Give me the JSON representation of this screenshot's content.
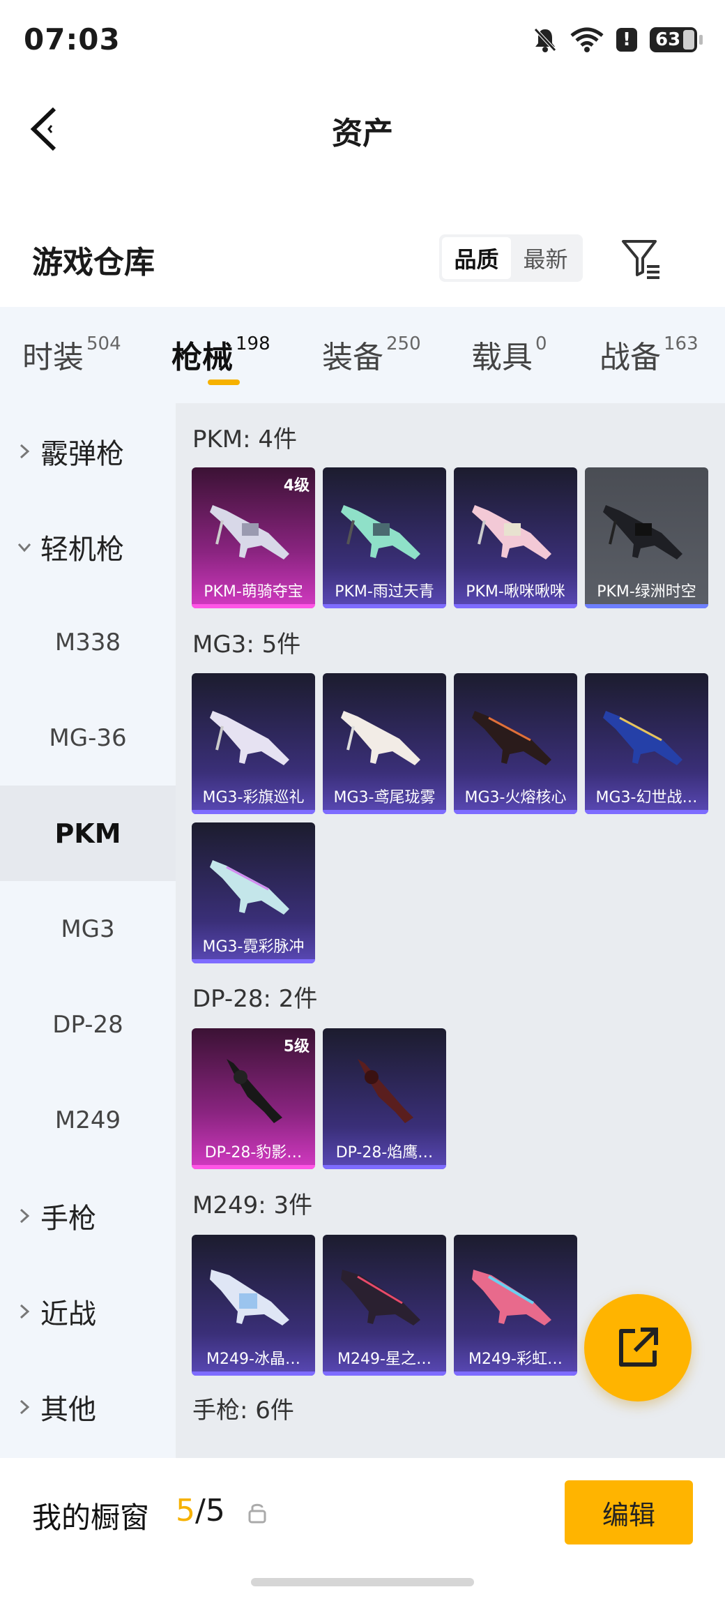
{
  "status_bar": {
    "time": "07:03",
    "battery": "63",
    "alert": "!"
  },
  "header": {
    "title": "资产"
  },
  "warehouse": {
    "title": "游戏仓库",
    "sort_options": [
      "品质",
      "最新"
    ],
    "sort_selected": "品质"
  },
  "tabs": [
    {
      "label": "时装",
      "count": "504"
    },
    {
      "label": "枪械",
      "count": "198"
    },
    {
      "label": "装备",
      "count": "250"
    },
    {
      "label": "载具",
      "count": "0"
    },
    {
      "label": "战备",
      "count": "163"
    }
  ],
  "tab_active": "枪械",
  "sidebar": {
    "groups": [
      {
        "label": "霰弹枪",
        "expanded": false
      },
      {
        "label": "轻机枪",
        "expanded": true
      },
      {
        "label": "手枪",
        "expanded": false
      },
      {
        "label": "近战",
        "expanded": false
      },
      {
        "label": "其他",
        "expanded": false
      }
    ],
    "sub_items": [
      "M338",
      "MG-36",
      "PKM",
      "MG3",
      "DP-28",
      "M249"
    ],
    "selected": "PKM"
  },
  "sections": [
    {
      "title": "PKM: 4件",
      "items": [
        {
          "name": "PKM-萌骑夺宝",
          "level": "4级",
          "rarity": "legendary"
        },
        {
          "name": "PKM-雨过天青",
          "level": "",
          "rarity": "epic"
        },
        {
          "name": "PKM-啾咪啾咪",
          "level": "",
          "rarity": "epic"
        },
        {
          "name": "PKM-绿洲时空",
          "level": "",
          "rarity": "common"
        }
      ]
    },
    {
      "title": "MG3: 5件",
      "items": [
        {
          "name": "MG3-彩旗巡礼",
          "level": "",
          "rarity": "epic"
        },
        {
          "name": "MG3-鸢尾珑雾",
          "level": "",
          "rarity": "epic"
        },
        {
          "name": "MG3-火熔核心",
          "level": "",
          "rarity": "epic"
        },
        {
          "name": "MG3-幻世战…",
          "level": "",
          "rarity": "epic"
        },
        {
          "name": "MG3-霓彩脉冲",
          "level": "",
          "rarity": "epic"
        }
      ]
    },
    {
      "title": "DP-28: 2件",
      "items": [
        {
          "name": "DP-28-豹影…",
          "level": "5级",
          "rarity": "legendary"
        },
        {
          "name": "DP-28-焰鹰…",
          "level": "",
          "rarity": "epic"
        }
      ]
    },
    {
      "title": "M249: 3件",
      "items": [
        {
          "name": "M249-冰晶…",
          "level": "",
          "rarity": "epic"
        },
        {
          "name": "M249-星之…",
          "level": "",
          "rarity": "epic"
        },
        {
          "name": "M249-彩虹…",
          "level": "",
          "rarity": "epic"
        }
      ]
    },
    {
      "title": "手枪: 6件",
      "items": []
    }
  ],
  "showcase": {
    "label": "我的橱窗",
    "current": "5",
    "separator": "/",
    "total": "5",
    "edit_label": "编辑"
  },
  "colors": {
    "accent": "#ffb400",
    "legendary": "#d33ac2",
    "epic": "#5a49b7",
    "common": "#5b5f67"
  }
}
